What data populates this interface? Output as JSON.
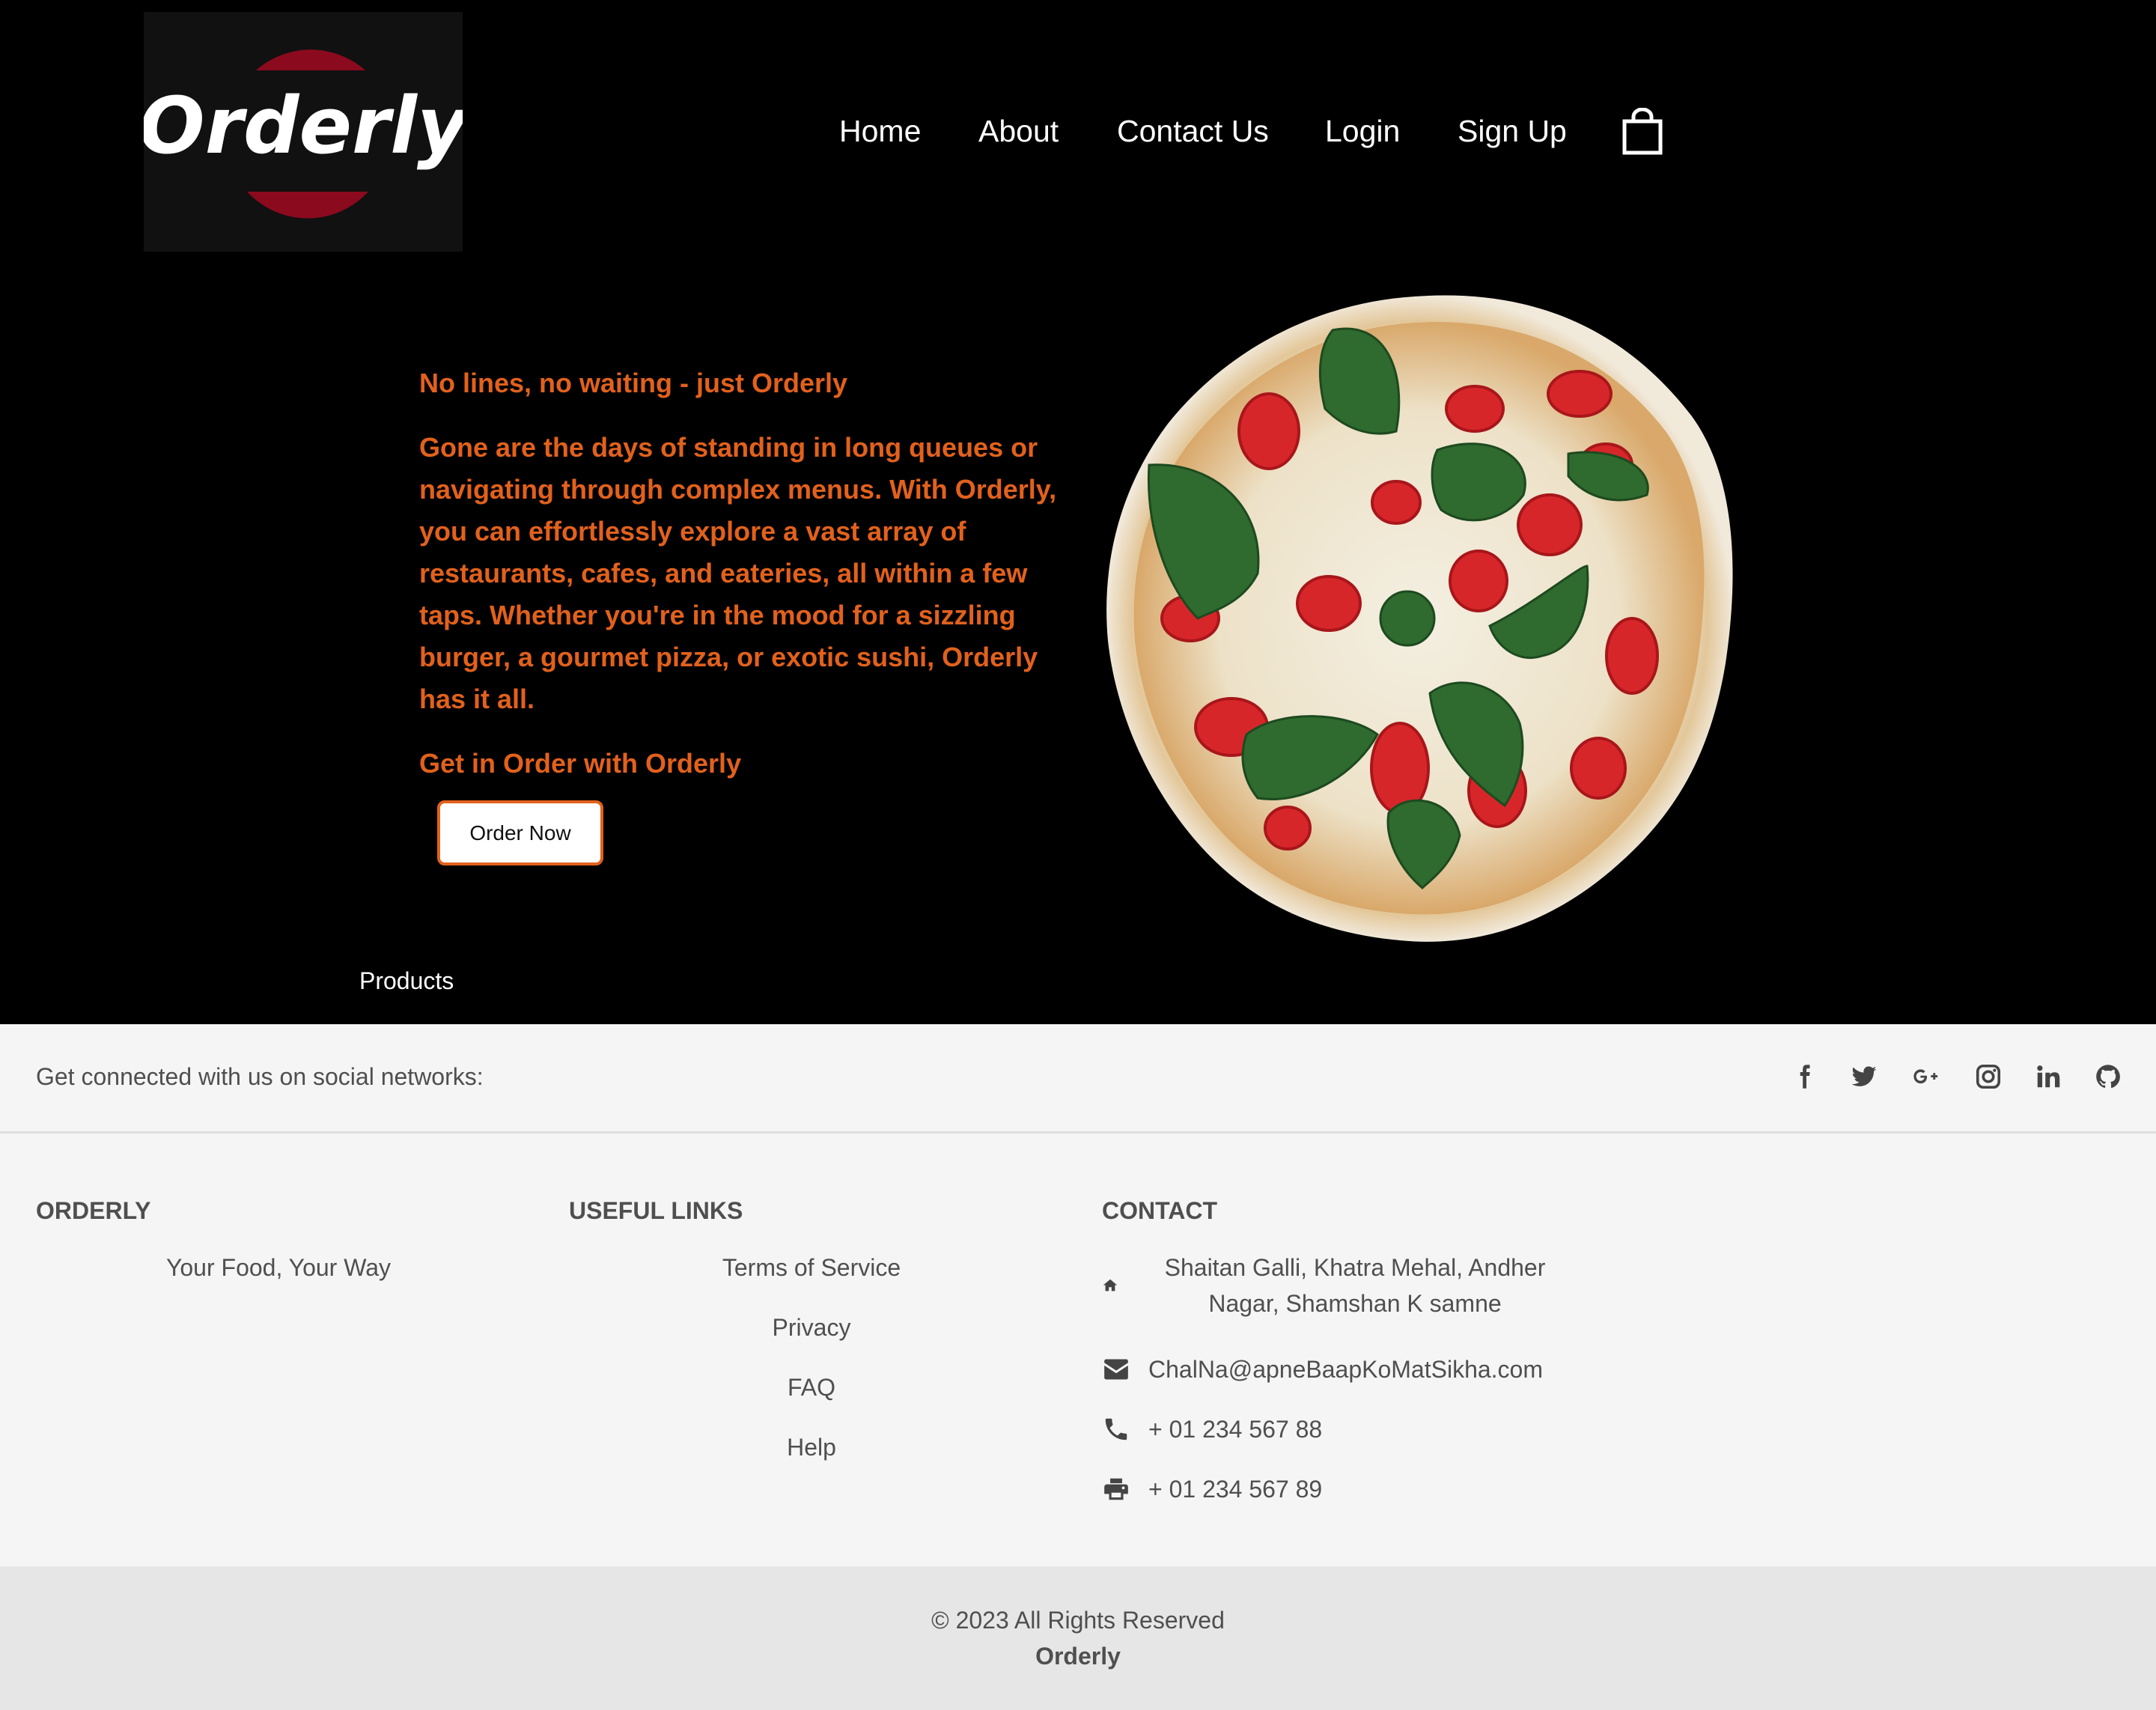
{
  "header": {
    "logo_text": "Orderly",
    "nav": [
      "Home",
      "About",
      "Contact Us",
      "Login",
      "Sign Up"
    ]
  },
  "hero": {
    "tagline": "No lines, no waiting - just Orderly",
    "description": "Gone are the days of standing in long queues or navigating through complex menus. With Orderly, you can effortlessly explore a vast array of restaurants, cafes, and eateries, all within a few taps. Whether you're in the mood for a sizzling burger, a gourmet pizza, or exotic sushi, Orderly has it all.",
    "cta_title": "Get in Order with Orderly",
    "order_button": "Order Now",
    "products_link": "Products"
  },
  "social": {
    "text": "Get connected with us on social networks:",
    "icons": [
      "facebook-icon",
      "twitter-icon",
      "google-plus-icon",
      "instagram-icon",
      "linkedin-icon",
      "github-icon"
    ]
  },
  "footer": {
    "brand": {
      "heading": "ORDERLY",
      "slogan": "Your Food, Your Way"
    },
    "useful_links": {
      "heading": "USEFUL LINKS",
      "links": [
        "Terms of Service",
        "Privacy",
        "FAQ",
        "Help"
      ]
    },
    "contact": {
      "heading": "CONTACT",
      "address": "Shaitan Galli, Khatra Mehal, Andher Nagar, Shamshan K samne",
      "email": "ChalNa@apneBaapKoMatSikha.com",
      "phone": "+ 01 234 567 88",
      "fax": "+ 01 234 567 89"
    }
  },
  "bottom": {
    "copyright": "© 2023 All Rights Reserved",
    "brand": "Orderly"
  },
  "colors": {
    "accent": "#e2611c",
    "logo_red": "#8b0a1e",
    "hero_bg": "#000000",
    "footer_bg": "#f5f5f5",
    "bottom_bg": "#e6e6e6",
    "text_gray": "#4f4f4f"
  }
}
